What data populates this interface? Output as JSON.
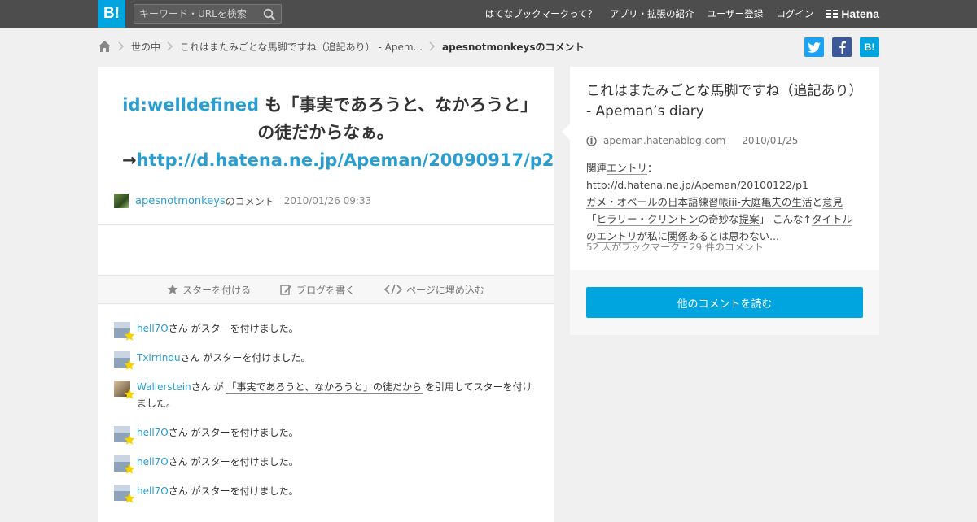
{
  "header": {
    "logo": "B!",
    "search_placeholder": "キーワード・URLを検索",
    "nav": [
      "はてなブックマークって？",
      "アプリ・拡張の紹介",
      "ユーザー登録",
      "ログイン"
    ],
    "brand": "Hatena"
  },
  "breadcrumb": {
    "items": [
      "世の中",
      "これはまたみごとな馬脚ですね（追記あり） - Apem..."
    ],
    "current": "apesnotmonkeysのコメント"
  },
  "share": {
    "hatena_label": "B!"
  },
  "comment": {
    "user_id": "id:welldefined",
    "text": " も「事実であろうと、なかろうと」の徒だからなぁ。→",
    "link": "http://d.hatena.ne.jp/Apeman/20090917/p2",
    "username": "apesnotmonkeys",
    "suffix": "のコメント",
    "date": "2010/01/26 09:33"
  },
  "actions": {
    "star": "スターを付ける",
    "blog": "ブログを書く",
    "embed": "ページに埋め込む"
  },
  "stars": [
    {
      "user": "hell7O",
      "text": "さん がスターを付けました。"
    },
    {
      "user": "Txirrindu",
      "text": "さん がスターを付けました。"
    },
    {
      "user": "Wallerstein",
      "pre": "さん が",
      "quote": "「事実であろうと、なかろうと」の徒だから",
      "text": "を引用してスターを付けました。"
    },
    {
      "user": "hell7O",
      "text": "さん がスターを付けました。"
    },
    {
      "user": "hell7O",
      "text": "さん がスターを付けました。"
    },
    {
      "user": "hell7O",
      "text": "さん がスターを付けました。"
    }
  ],
  "entry": {
    "title": "これはまたみごとな馬脚ですね（追記あり） - Apeman’s diary",
    "domain": "apeman.hatenablog.com",
    "date": "2010/01/25",
    "summary_1": "関連",
    "summary_2": "エントリ",
    "summary_3": "：http://d.hatena.ne.jp/Apeman/20100122/p1",
    "summary_4": "ガメ・オベールの日本語練習帳iii-大庭亀夫の",
    "summary_5": "生活",
    "summary_6": "と",
    "summary_7": "意見",
    "summary_8": "「",
    "summary_9": "ヒラリー・クリントン",
    "summary_10": "の奇妙な",
    "summary_11": "提案",
    "summary_12": "」 こんな↑",
    "summary_13": "タイトル",
    "summary_14": "の",
    "summary_15": "エントリ",
    "summary_16": "が私に",
    "summary_17": "関係",
    "summary_18": "あるとは思わない...",
    "count": "52 人がブックマーク・29 件のコメント",
    "read_button": "他のコメントを読む"
  },
  "colors": {
    "accent": "#00a4de",
    "link": "#2b9ed0",
    "topbar": "#4d4d4d"
  }
}
